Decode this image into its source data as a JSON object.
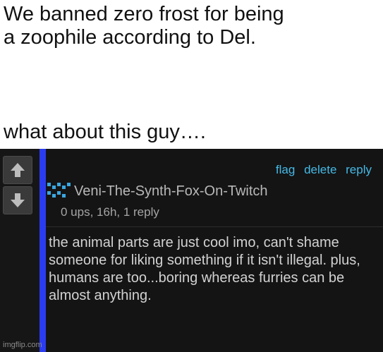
{
  "meme": {
    "caption_top": "We banned zero frost for being\na zoophile according to Del.",
    "caption_bottom": "what about this guy…."
  },
  "comment": {
    "actions": {
      "flag": "flag",
      "delete": "delete",
      "reply": "reply"
    },
    "avatar_icon": "pixel-avatar-icon",
    "username": "Veni-The-Synth-Fox-On-Twitch",
    "meta": "0 ups, 16h, 1 reply",
    "body": "the animal parts are just cool imo, can't shame someone for liking something if it isn't illegal. plus, humans are too...boring whereas furries can be almost anything."
  },
  "vote": {
    "up_icon": "arrow-up-icon",
    "down_icon": "arrow-down-icon"
  },
  "watermark": "imgflip.com",
  "colors": {
    "accent_bar": "#2b3cf0",
    "link": "#45b9e6",
    "avatar": "#3aa7e0"
  }
}
